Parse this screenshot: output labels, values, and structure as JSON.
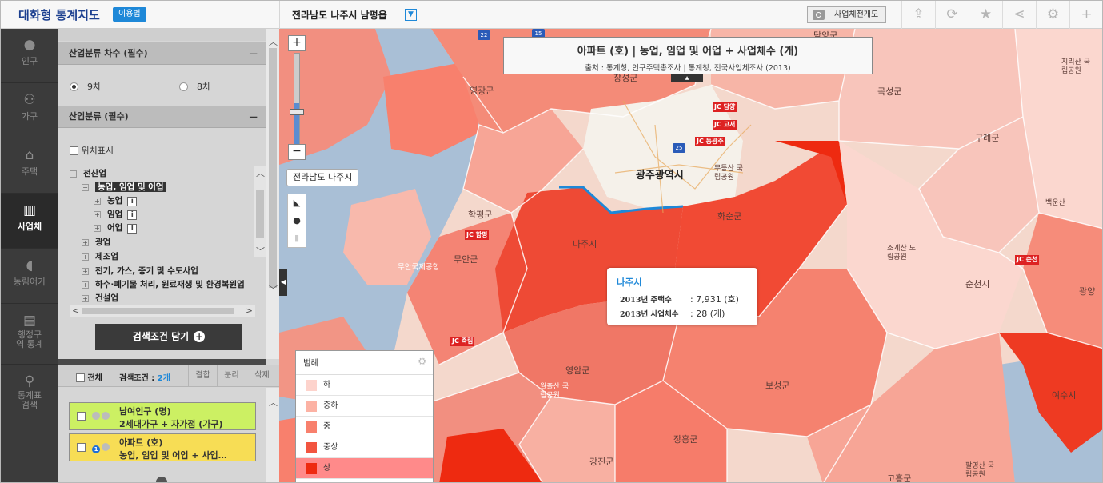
{
  "header": {
    "app_title": "대화형 통계지도",
    "guide": "이용법",
    "region": "전라남도 나주시 남평읍",
    "full_mode": "사업체전개도"
  },
  "nav": [
    {
      "label": "인구",
      "icon": "person-icon"
    },
    {
      "label": "가구",
      "icon": "family-icon"
    },
    {
      "label": "주택",
      "icon": "house-icon"
    },
    {
      "label": "사업체",
      "icon": "building-icon"
    },
    {
      "label": "농림어가",
      "icon": "pig-icon"
    },
    {
      "label": "행정구역 통계",
      "icon": "map-icon"
    },
    {
      "label": "통계표 검색",
      "icon": "search-icon"
    }
  ],
  "panel": {
    "section1": "산업분류 차수 (필수)",
    "radio_9": "9차",
    "radio_8": "8차",
    "section2": "산업분류 (필수)",
    "position_show": "위치표시",
    "tree": {
      "root": "전산업",
      "selected": "농업, 임업 및 어업",
      "children": [
        "농업",
        "임업",
        "어업"
      ],
      "items": [
        "광업",
        "제조업",
        "전기, 가스, 증기 및 수도사업",
        "하수·폐기물 처리, 원료재생 및 환경복원업",
        "건설업"
      ]
    },
    "info_mark": "i",
    "search_btn": "검색조건 담기",
    "search_plus": "+",
    "select_all": "전체",
    "cond_label": "검색조건 : ",
    "cond_count": "2개",
    "tabs": [
      "결합",
      "분리",
      "삭제"
    ],
    "cards": [
      {
        "line1": "남여인구 (명)",
        "line2": "2세대가구 + 자가점 (가구)",
        "color": "#ccf063"
      },
      {
        "line1": "아파트 (호)",
        "line2": "농업, 임업 및 어업 + 사업…",
        "color": "#f7dd55",
        "badge": "1"
      }
    ]
  },
  "map": {
    "title": "아파트 (호) | 농업, 임업 및 어업 + 사업체수 (개)",
    "source": "출처 : 통계청, 인구주택총조사 | 통계청, 전국사업체조사 (2013)",
    "location_label": "전라남도 나주시",
    "popup": {
      "name": "나주시",
      "row1_key": "2013년 주택수",
      "row1_val": ": 7,931 (호)",
      "row2_key": "2013년 사업체수",
      "row2_val": ": 28 (개)"
    },
    "legend": {
      "title": "범례",
      "items": [
        {
          "label": "하",
          "color": "#fdd3cc"
        },
        {
          "label": "중하",
          "color": "#fcb2a4"
        },
        {
          "label": "중",
          "color": "#f8806d"
        },
        {
          "label": "중상",
          "color": "#f25540"
        },
        {
          "label": "상",
          "color": "#ee2a10"
        }
      ]
    },
    "places": [
      "영광군",
      "장성군",
      "담양군",
      "곡성군",
      "구례군",
      "함평군",
      "무안군",
      "광주광역시",
      "화순군",
      "나주시",
      "영암군",
      "보성군",
      "장흥군",
      "강진군",
      "고흥군",
      "순천시",
      "여수시",
      "무등산 국립공원",
      "조계산 도립공원",
      "지리산 국립공원",
      "백운산",
      "무안국제공항",
      "광양",
      "월출산 국립공원",
      "팔영산 국립공원"
    ],
    "jc_labels": [
      "JC 담양",
      "JC 고서",
      "JC 동광주",
      "JC 함평",
      "JC 죽림",
      "JC 순천"
    ],
    "highways": [
      "22",
      "15",
      "25"
    ]
  }
}
